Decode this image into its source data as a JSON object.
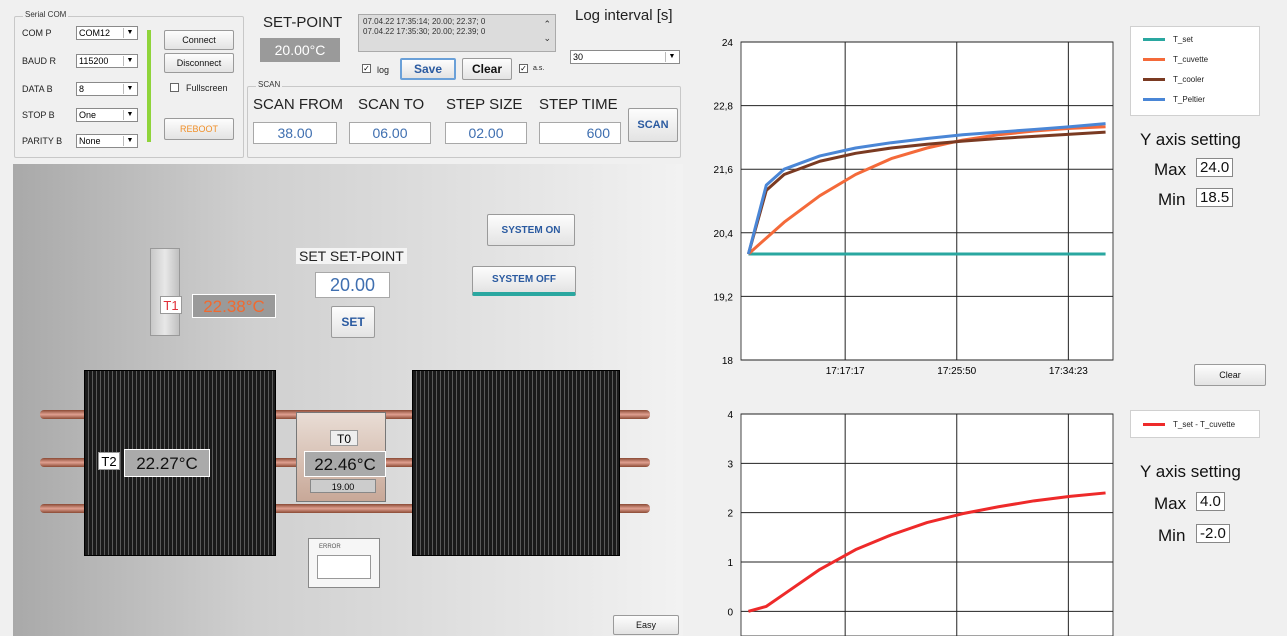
{
  "serial": {
    "title": "Serial COM",
    "com_label": "COM P",
    "com_value": "COM12",
    "baud_label": "BAUD R",
    "baud_value": "115200",
    "data_label": "DATA B",
    "data_value": "8",
    "stop_label": "STOP B",
    "stop_value": "One",
    "parity_label": "PARITY B",
    "parity_value": "None",
    "connect": "Connect",
    "disconnect": "Disconnect",
    "fullscreen": "Fullscreen",
    "reboot": "REBOOT"
  },
  "setpoint": {
    "label": "SET-POINT",
    "value": "20.00°C"
  },
  "log": {
    "lines": [
      "07.04.22 17:35:14; 20.00; 22.37; 0",
      "07.04.22 17:35:30; 20.00; 22.39; 0"
    ],
    "log_chk": "log",
    "save": "Save",
    "clear": "Clear",
    "as_chk": "a.s.",
    "interval_label": "Log interval [s]",
    "interval_value": "30"
  },
  "scan": {
    "title": "SCAN",
    "from_label": "SCAN FROM",
    "from_value": "38.00",
    "to_label": "SCAN TO",
    "to_value": "06.00",
    "step_label": "STEP SIZE",
    "step_value": "02.00",
    "time_label": "STEP TIME",
    "time_value": "600",
    "button": "SCAN"
  },
  "device": {
    "set_setpoint_label": "SET SET-POINT",
    "set_setpoint_value": "20.00",
    "set_button": "SET",
    "system_on": "SYSTEM ON",
    "system_off": "SYSTEM OFF",
    "t1_label": "T1",
    "t1_value": "22.38°C",
    "t2_label": "T2",
    "t2_value": "22.27°C",
    "t0_label": "T0",
    "t0_value": "22.46°C",
    "t0_sub": "19.00",
    "error_label": "ERROR",
    "easy": "Easy"
  },
  "chart1": {
    "y_ticks": [
      "24",
      "22,8",
      "21,6",
      "20,4",
      "19,2",
      "18"
    ],
    "x_ticks": [
      "17:17:17",
      "17:25:50",
      "17:34:23"
    ],
    "legend": [
      "T_set",
      "T_cuvette",
      "T_cooler",
      "T_Peltier"
    ],
    "yaxis_title": "Y axis setting",
    "max_label": "Max",
    "max_value": "24.0",
    "min_label": "Min",
    "min_value": "18.5",
    "clear": "Clear"
  },
  "chart2": {
    "y_ticks": [
      "4",
      "3",
      "2",
      "1",
      "0"
    ],
    "legend": [
      "T_set - T_cuvette"
    ],
    "yaxis_title": "Y axis setting",
    "max_label": "Max",
    "max_value": "4.0",
    "min_label": "Min",
    "min_value": "-2.0"
  },
  "colors": {
    "t_set": "#2aa7a0",
    "t_cuvette": "#f46a3a",
    "t_cooler": "#7a3a22",
    "t_peltier": "#4a86d6",
    "diff": "#ee2a2a",
    "t1_text": "#f06a30"
  },
  "chart_data": [
    {
      "type": "line",
      "x": [
        0,
        0.05,
        0.1,
        0.2,
        0.3,
        0.4,
        0.5,
        0.6,
        0.7,
        0.8,
        0.9,
        1.0
      ],
      "x_ticks": [
        "17:17:17",
        "17:25:50",
        "17:34:23"
      ],
      "ylim": [
        18,
        24
      ],
      "series": [
        {
          "name": "T_set",
          "values": [
            20.0,
            20.0,
            20.0,
            20.0,
            20.0,
            20.0,
            20.0,
            20.0,
            20.0,
            20.0,
            20.0,
            20.0
          ]
        },
        {
          "name": "T_cuvette",
          "values": [
            20.0,
            20.3,
            20.6,
            21.1,
            21.5,
            21.8,
            22.0,
            22.15,
            22.25,
            22.32,
            22.37,
            22.4
          ]
        },
        {
          "name": "T_cooler",
          "values": [
            20.0,
            21.2,
            21.5,
            21.75,
            21.9,
            22.0,
            22.07,
            22.13,
            22.18,
            22.22,
            22.26,
            22.3
          ]
        },
        {
          "name": "T_Peltier",
          "values": [
            20.0,
            21.3,
            21.6,
            21.85,
            22.0,
            22.1,
            22.18,
            22.25,
            22.3,
            22.35,
            22.4,
            22.46
          ]
        }
      ]
    },
    {
      "type": "line",
      "x": [
        0,
        0.05,
        0.1,
        0.2,
        0.3,
        0.4,
        0.5,
        0.6,
        0.7,
        0.8,
        0.9,
        1.0
      ],
      "ylim": [
        -0.5,
        4
      ],
      "series": [
        {
          "name": "T_set - T_cuvette",
          "values": [
            0.0,
            0.1,
            0.35,
            0.85,
            1.25,
            1.55,
            1.8,
            1.98,
            2.12,
            2.24,
            2.33,
            2.4
          ]
        }
      ]
    }
  ]
}
